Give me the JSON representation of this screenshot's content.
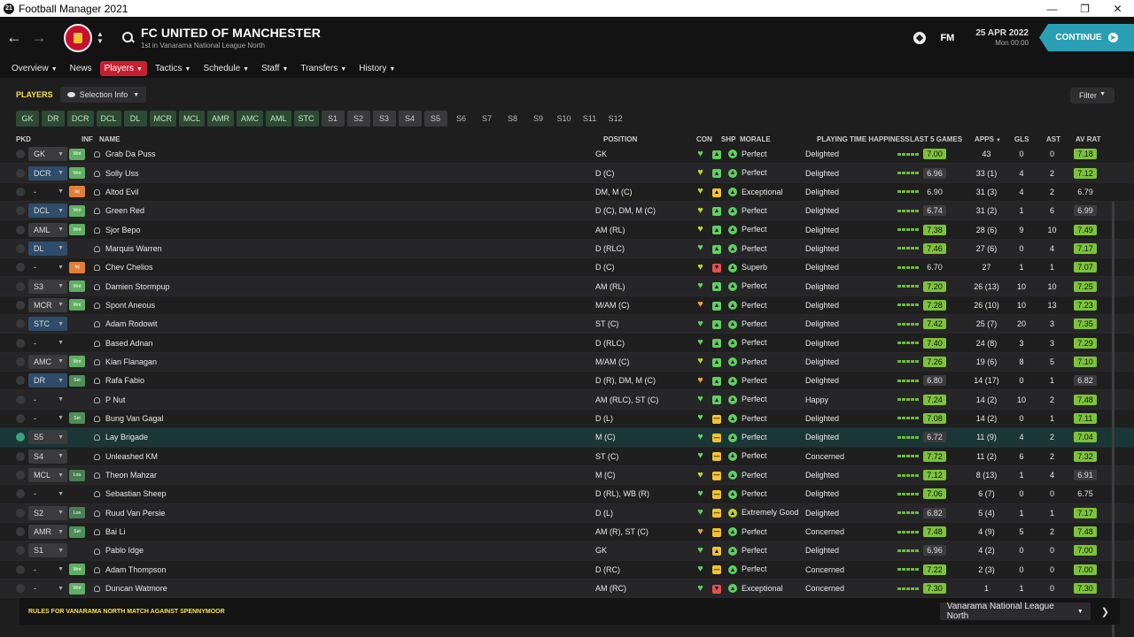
{
  "window": {
    "title": "Football Manager 2021",
    "icon_label": "21"
  },
  "header": {
    "club_name": "FC UNITED OF MANCHESTER",
    "club_sub": "1st in Vanarama National League North",
    "fm_logo": "FM",
    "date": "25 APR 2022",
    "day": "Mon 00:00",
    "continue_label": "CONTINUE"
  },
  "menu": [
    {
      "label": "Overview",
      "active": false
    },
    {
      "label": "News",
      "active": false,
      "nochev": true
    },
    {
      "label": "Players",
      "active": true
    },
    {
      "label": "Tactics",
      "active": false
    },
    {
      "label": "Schedule",
      "active": false
    },
    {
      "label": "Staff",
      "active": false
    },
    {
      "label": "Transfers",
      "active": false
    },
    {
      "label": "History",
      "active": false
    }
  ],
  "players_label": "PLAYERS",
  "selection_info": "Selection Info",
  "filter_label": "Filter",
  "position_filters": [
    {
      "label": "GK",
      "style": "green"
    },
    {
      "label": "DR",
      "style": "green"
    },
    {
      "label": "DCR",
      "style": "green"
    },
    {
      "label": "DCL",
      "style": "green"
    },
    {
      "label": "DL",
      "style": "green"
    },
    {
      "label": "MCR",
      "style": "green"
    },
    {
      "label": "MCL",
      "style": "green"
    },
    {
      "label": "AMR",
      "style": "green"
    },
    {
      "label": "AMC",
      "style": "green"
    },
    {
      "label": "AML",
      "style": "green"
    },
    {
      "label": "STC",
      "style": "green"
    },
    {
      "label": "S1",
      "style": "grey"
    },
    {
      "label": "S2",
      "style": "grey"
    },
    {
      "label": "S3",
      "style": "grey"
    },
    {
      "label": "S4",
      "style": "grey"
    },
    {
      "label": "S5",
      "style": "grey"
    },
    {
      "label": "S6",
      "style": "plain"
    },
    {
      "label": "S7",
      "style": "plain"
    },
    {
      "label": "S8",
      "style": "plain"
    },
    {
      "label": "S9",
      "style": "plain"
    },
    {
      "label": "S10",
      "style": "plain"
    },
    {
      "label": "S11",
      "style": "plain"
    },
    {
      "label": "S12",
      "style": "plain"
    }
  ],
  "columns": {
    "pkd": "PKD",
    "inf": "INF",
    "name": "NAME",
    "pos": "POSITION",
    "con": "CON",
    "shp": "SHP",
    "morale": "MORALE",
    "pth": "PLAYING TIME HAPPINESS",
    "last5": "LAST 5 GAMES",
    "apps": "APPS",
    "gls": "GLS",
    "ast": "AST",
    "avrat": "AV RAT"
  },
  "players": [
    {
      "pkd": "GK",
      "pkdstyle": "grey",
      "inf": "Wnt",
      "name": "Grab Da Puss",
      "pos": "GK",
      "shp": "up",
      "morale": "Perfect",
      "pth": "Delighted",
      "last5": "7.00",
      "l5": "hi",
      "apps": "43",
      "gls": "0",
      "ast": "0",
      "avrat": "7.18",
      "av": "hi"
    },
    {
      "pkd": "DCR",
      "pkdstyle": "blue",
      "inf": "Wnt",
      "name": "Solly Uss",
      "pos": "D (C)",
      "shp": "up",
      "morale": "Perfect",
      "pth": "Delighted",
      "last5": "6.96",
      "l5": "lo",
      "apps": "33 (1)",
      "gls": "4",
      "ast": "2",
      "avrat": "7.12",
      "av": "hi"
    },
    {
      "pkd": "-",
      "pkdstyle": "none",
      "inf": "Inj",
      "name": "Altod Evil",
      "pos": "DM, M (C)",
      "shp": "warn",
      "morale": "Exceptional",
      "pth": "Delighted",
      "last5": "6.90",
      "l5": "plain",
      "apps": "31 (3)",
      "gls": "4",
      "ast": "2",
      "avrat": "6.79",
      "av": "plain"
    },
    {
      "pkd": "DCL",
      "pkdstyle": "blue",
      "inf": "Wnt",
      "name": "Green Red",
      "pos": "D (C), DM, M (C)",
      "shp": "up",
      "morale": "Perfect",
      "pth": "Delighted",
      "last5": "6.74",
      "l5": "lo",
      "apps": "31 (2)",
      "gls": "1",
      "ast": "6",
      "avrat": "6.99",
      "av": "lo"
    },
    {
      "pkd": "AML",
      "pkdstyle": "grey",
      "inf": "Wnt",
      "name": "Sjor Bepo",
      "pos": "AM (RL)",
      "shp": "up",
      "morale": "Perfect",
      "pth": "Delighted",
      "last5": "7.38",
      "l5": "hi",
      "apps": "28 (6)",
      "gls": "9",
      "ast": "10",
      "avrat": "7.49",
      "av": "hi"
    },
    {
      "pkd": "DL",
      "pkdstyle": "blue",
      "inf": "",
      "name": "Marquis Warren",
      "pos": "D (RLC)",
      "shp": "up",
      "morale": "Perfect",
      "pth": "Delighted",
      "last5": "7.46",
      "l5": "hi",
      "apps": "27 (6)",
      "gls": "0",
      "ast": "4",
      "avrat": "7.17",
      "av": "hi"
    },
    {
      "pkd": "-",
      "pkdstyle": "none",
      "inf": "Inj",
      "name": "Chev Chelios",
      "pos": "D (C)",
      "shp": "down",
      "morale": "Superb",
      "pth": "Delighted",
      "last5": "6.70",
      "l5": "plain",
      "apps": "27",
      "gls": "1",
      "ast": "1",
      "avrat": "7.07",
      "av": "hi"
    },
    {
      "pkd": "S3",
      "pkdstyle": "grey",
      "inf": "Wnt",
      "name": "Damien Stormpup",
      "pos": "AM (RL)",
      "shp": "up",
      "morale": "Perfect",
      "pth": "Delighted",
      "last5": "7.20",
      "l5": "hi",
      "apps": "26 (13)",
      "gls": "10",
      "ast": "10",
      "avrat": "7.25",
      "av": "hi"
    },
    {
      "pkd": "MCR",
      "pkdstyle": "grey",
      "inf": "Wnt",
      "name": "Spont Aneous",
      "pos": "M/AM (C)",
      "shp": "up",
      "morale": "Perfect",
      "pth": "Delighted",
      "last5": "7.28",
      "l5": "hi",
      "apps": "26 (10)",
      "gls": "10",
      "ast": "13",
      "avrat": "7.23",
      "av": "hi"
    },
    {
      "pkd": "STC",
      "pkdstyle": "blue",
      "inf": "",
      "name": "Adam Rodowit",
      "pos": "ST (C)",
      "shp": "up",
      "morale": "Perfect",
      "pth": "Delighted",
      "last5": "7.42",
      "l5": "hi",
      "apps": "25 (7)",
      "gls": "20",
      "ast": "3",
      "avrat": "7.35",
      "av": "hi"
    },
    {
      "pkd": "-",
      "pkdstyle": "none",
      "inf": "",
      "name": "Based Adnan",
      "pos": "D (RLC)",
      "shp": "up",
      "morale": "Perfect",
      "pth": "Delighted",
      "last5": "7.40",
      "l5": "hi",
      "apps": "24 (8)",
      "gls": "3",
      "ast": "3",
      "avrat": "7.29",
      "av": "hi"
    },
    {
      "pkd": "AMC",
      "pkdstyle": "grey",
      "inf": "Wnt",
      "name": "Kian Flanagan",
      "pos": "M/AM (C)",
      "shp": "up",
      "morale": "Perfect",
      "pth": "Delighted",
      "last5": "7.26",
      "l5": "hi",
      "apps": "19 (6)",
      "gls": "8",
      "ast": "5",
      "avrat": "7.10",
      "av": "hi"
    },
    {
      "pkd": "DR",
      "pkdstyle": "blue",
      "inf": "Set",
      "name": "Rafa Fabio",
      "pos": "D (R), DM, M (C)",
      "shp": "up",
      "morale": "Perfect",
      "pth": "Delighted",
      "last5": "6.80",
      "l5": "lo",
      "apps": "14 (17)",
      "gls": "0",
      "ast": "1",
      "avrat": "6.82",
      "av": "lo"
    },
    {
      "pkd": "-",
      "pkdstyle": "none",
      "inf": "",
      "name": "P Nut",
      "pos": "AM (RLC), ST (C)",
      "shp": "up",
      "morale": "Perfect",
      "pth": "Happy",
      "last5": "7.24",
      "l5": "hi",
      "apps": "14 (2)",
      "gls": "10",
      "ast": "2",
      "avrat": "7.48",
      "av": "hi"
    },
    {
      "pkd": "-",
      "pkdstyle": "none",
      "inf": "Set",
      "name": "Bung Van Gagal",
      "pos": "D (L)",
      "shp": "neutral",
      "morale": "Perfect",
      "pth": "Delighted",
      "last5": "7.08",
      "l5": "hi",
      "apps": "14 (2)",
      "gls": "0",
      "ast": "1",
      "avrat": "7.11",
      "av": "hi"
    },
    {
      "pkd": "S5",
      "pkdstyle": "grey",
      "inf": "",
      "name": "Lay Brigade",
      "pos": "M (C)",
      "shp": "neutral",
      "morale": "Perfect",
      "pth": "Delighted",
      "last5": "6.72",
      "l5": "lo",
      "apps": "11 (9)",
      "gls": "4",
      "ast": "2",
      "avrat": "7.04",
      "av": "hi",
      "selected": true
    },
    {
      "pkd": "S4",
      "pkdstyle": "grey",
      "inf": "",
      "name": "Unleashed KM",
      "pos": "ST (C)",
      "shp": "neutral",
      "morale": "Perfect",
      "pth": "Concerned",
      "last5": "7.72",
      "l5": "hi",
      "apps": "11 (2)",
      "gls": "6",
      "ast": "2",
      "avrat": "7.32",
      "av": "hi"
    },
    {
      "pkd": "MCL",
      "pkdstyle": "grey",
      "inf": "Loa",
      "name": "Theon Mahzar",
      "pos": "M (C)",
      "shp": "neutral",
      "morale": "Perfect",
      "pth": "Delighted",
      "last5": "7.12",
      "l5": "hi",
      "apps": "8 (13)",
      "gls": "1",
      "ast": "4",
      "avrat": "6.91",
      "av": "lo"
    },
    {
      "pkd": "-",
      "pkdstyle": "none",
      "inf": "",
      "name": "Sebastian Sheep",
      "pos": "D (RL), WB (R)",
      "shp": "neutral",
      "morale": "Perfect",
      "pth": "Delighted",
      "last5": "7.06",
      "l5": "hi",
      "apps": "6 (7)",
      "gls": "0",
      "ast": "0",
      "avrat": "6.75",
      "av": "plain"
    },
    {
      "pkd": "S2",
      "pkdstyle": "grey",
      "inf": "Loa",
      "name": "Ruud Van Persie",
      "pos": "D (L)",
      "shp": "neutral",
      "morale": "Extremely Good",
      "pth": "Delighted",
      "last5": "6.82",
      "l5": "lo",
      "apps": "5 (4)",
      "gls": "1",
      "ast": "1",
      "avrat": "7.17",
      "av": "hi"
    },
    {
      "pkd": "AMR",
      "pkdstyle": "grey",
      "inf": "Set",
      "name": "Bai Li",
      "pos": "AM (R), ST (C)",
      "shp": "neutral",
      "morale": "Perfect",
      "pth": "Concerned",
      "last5": "7.48",
      "l5": "hi",
      "apps": "4 (9)",
      "gls": "5",
      "ast": "2",
      "avrat": "7.48",
      "av": "hi"
    },
    {
      "pkd": "S1",
      "pkdstyle": "grey",
      "inf": "",
      "name": "Pablo Idge",
      "pos": "GK",
      "shp": "warn",
      "morale": "Perfect",
      "pth": "Delighted",
      "last5": "6.96",
      "l5": "lo",
      "apps": "4 (2)",
      "gls": "0",
      "ast": "0",
      "avrat": "7.00",
      "av": "hi"
    },
    {
      "pkd": "-",
      "pkdstyle": "none",
      "inf": "Wnt",
      "name": "Adam Thompson",
      "pos": "D (RC)",
      "shp": "neutral",
      "morale": "Perfect",
      "pth": "Concerned",
      "last5": "7.22",
      "l5": "hi",
      "apps": "2 (3)",
      "gls": "0",
      "ast": "0",
      "avrat": "7.00",
      "av": "hi"
    },
    {
      "pkd": "-",
      "pkdstyle": "none",
      "inf": "Wnt",
      "name": "Duncan Watmore",
      "pos": "AM (RC)",
      "shp": "down",
      "morale": "Exceptional",
      "pth": "Concerned",
      "last5": "7.30",
      "l5": "hi",
      "apps": "1",
      "gls": "1",
      "ast": "0",
      "avrat": "7.30",
      "av": "hi"
    }
  ],
  "bottom": {
    "title": "RULES FOR VANARAMA NORTH MATCH AGAINST SPENNYMOOR",
    "league": "Vanarama National League North"
  }
}
